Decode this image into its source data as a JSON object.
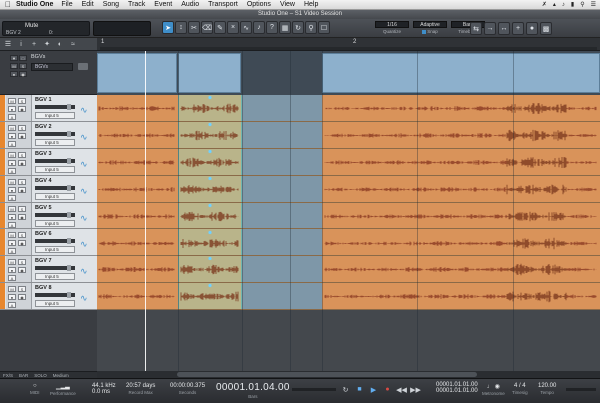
{
  "menubar": {
    "apple": "",
    "app": "Studio One",
    "items": [
      "File",
      "Edit",
      "Song",
      "Track",
      "Event",
      "Audio",
      "Transport",
      "Options",
      "View",
      "Help"
    ]
  },
  "window": {
    "title": "Studio One – S1 Video Session"
  },
  "toolbar": {
    "display_name": "Mute",
    "display_sub": "BGV 2",
    "display_num": "0:",
    "quantize": {
      "value": "1/16",
      "label": "Quantize"
    },
    "snap": {
      "value": "Adaptive",
      "label": "Snap"
    },
    "timebase": {
      "value": "Bars",
      "label": "Timebase"
    }
  },
  "ruler": {
    "marks": [
      "1",
      "2"
    ]
  },
  "folder": {
    "name": "BGVs",
    "selector": "BGVs"
  },
  "tracks": [
    {
      "name": "BGV 1",
      "input": "Input 5"
    },
    {
      "name": "BGV 2",
      "input": "Input 5"
    },
    {
      "name": "BGV 3",
      "input": "Input 5"
    },
    {
      "name": "BGV 4",
      "input": "Input 5"
    },
    {
      "name": "BGV 5",
      "input": "Input 5"
    },
    {
      "name": "BGV 6",
      "input": "Input 5"
    },
    {
      "name": "BGV 7",
      "input": "Input 5"
    },
    {
      "name": "BGV 8",
      "input": "Input 5"
    }
  ],
  "editbar": {
    "items": [
      "FX/S",
      "BAR",
      "SOLO",
      "Medium"
    ]
  },
  "transport": {
    "midi": "MIDI",
    "performance": "Performance",
    "sample_rate": "44.1 kHz",
    "latency": "0.0 ms",
    "record_max_value": "20:57 days",
    "record_max_label": "Record Max",
    "seconds_value": "00:00:00.375",
    "seconds_label": "Seconds",
    "position": "00001.01.04.00",
    "position_label": "Bars",
    "loop_start": "00001.01.01.00",
    "loop_end": "00001.01.01.00",
    "metronome_label": "Metronome",
    "timesig": "4 / 4",
    "timesig_label": "Timesig",
    "tempo": "120.00",
    "tempo_label": "Tempo"
  },
  "colors": {
    "track_color": "#e7872f",
    "clip_orange": "#d9935a",
    "selected_clip": "#b9b48a",
    "accent_blue": "#3f8ec9"
  }
}
